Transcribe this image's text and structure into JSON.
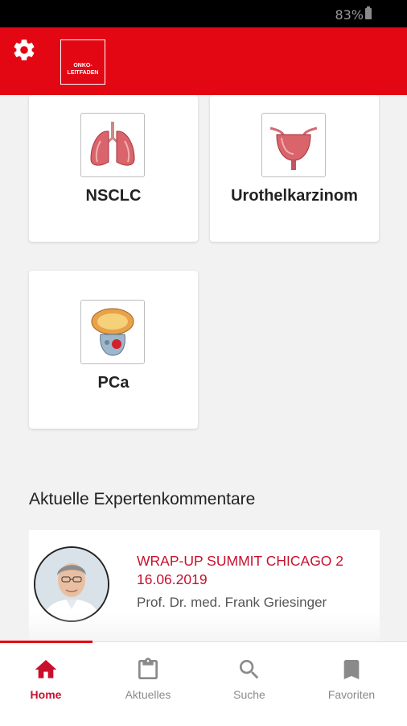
{
  "status_bar": {
    "battery": "83%"
  },
  "header": {
    "logo_line1": "ONKO-",
    "logo_line2": "LEITFADEN"
  },
  "categories": [
    {
      "label": "NSCLC",
      "icon": "lungs-icon"
    },
    {
      "label": "Urothelkarzinom",
      "icon": "bladder-icon"
    },
    {
      "label": "PCa",
      "icon": "prostate-icon"
    }
  ],
  "section": {
    "title": "Aktuelle Expertenkommentare"
  },
  "comments": [
    {
      "title": "WRAP-UP SUMMIT CHICAGO 2",
      "date": "16.06.2019",
      "author": "Prof. Dr. med. Frank Griesinger"
    }
  ],
  "nav": [
    {
      "label": "Home",
      "icon": "home-icon",
      "active": true
    },
    {
      "label": "Aktuelles",
      "icon": "clipboard-icon"
    },
    {
      "label": "Suche",
      "icon": "search-icon"
    },
    {
      "label": "Favoriten",
      "icon": "bookmark-icon"
    }
  ],
  "colors": {
    "brand": "#e30613",
    "accent_text": "#c8102e"
  }
}
